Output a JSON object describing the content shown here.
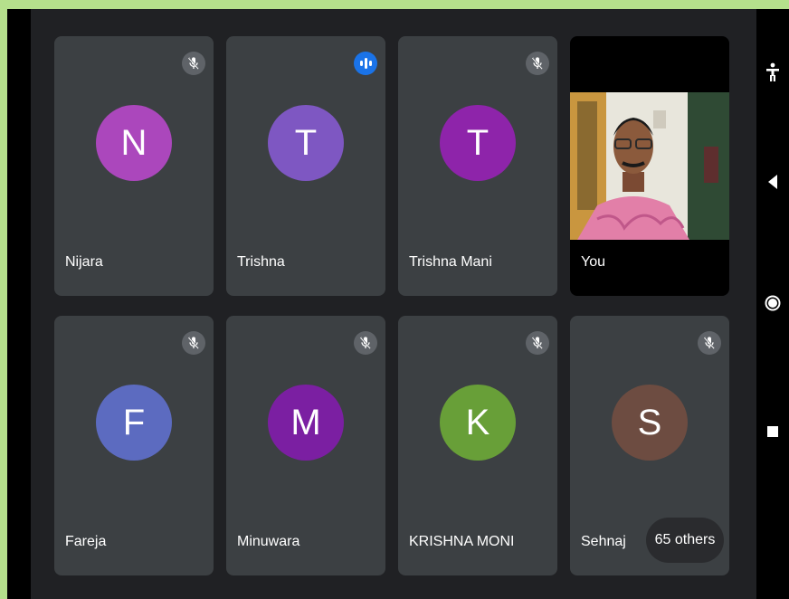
{
  "participants": [
    {
      "name": "Nijara",
      "initial": "N",
      "color": "#ab47bc",
      "status": "muted"
    },
    {
      "name": "Trishna",
      "initial": "T",
      "color": "#7e57c2",
      "status": "speaking"
    },
    {
      "name": "Trishna Mani",
      "initial": "T",
      "color": "#8e24aa",
      "status": "muted"
    },
    {
      "name": "You",
      "initial": "",
      "color": "#000000",
      "status": "video"
    },
    {
      "name": "Fareja",
      "initial": "F",
      "color": "#5c6bc0",
      "status": "muted"
    },
    {
      "name": "Minuwara",
      "initial": "M",
      "color": "#7b1fa2",
      "status": "muted"
    },
    {
      "name": "KRISHNA MONI",
      "initial": "K",
      "color": "#689f38",
      "status": "muted"
    },
    {
      "name": "Sehnaj",
      "initial": "S",
      "color": "#6d4c41",
      "status": "muted"
    }
  ],
  "others": {
    "label": "65 others"
  },
  "icons": {
    "mute": "mic-off-icon",
    "speaking": "audio-level-icon",
    "accessibility": "accessibility-icon",
    "back": "back-triangle-icon",
    "home": "home-circle-icon",
    "recents": "recents-square-icon"
  },
  "theme": {
    "background": "#202124",
    "tile": "#3c4043",
    "frame": "#b5e08c",
    "accent": "#1a73e8"
  }
}
